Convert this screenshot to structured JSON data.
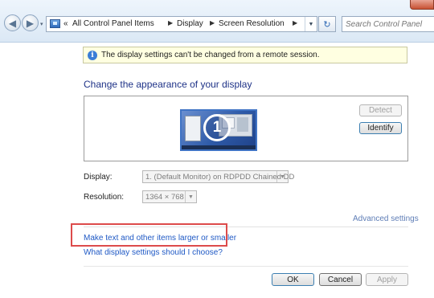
{
  "nav": {
    "back_glyph": "◀",
    "forward_glyph": "▶",
    "recent_glyph": "▾",
    "address_icon": "control-panel-icon",
    "breadcrumb_overflow": "«",
    "breadcrumbs": [
      "All Control Panel Items",
      "Display",
      "Screen Resolution"
    ],
    "refresh_glyph": "↻",
    "search_placeholder": "Search Control Panel"
  },
  "infobar": {
    "icon": "info-icon",
    "text": "The display settings can't be changed from a remote session."
  },
  "heading": "Change the appearance of your display",
  "preview": {
    "monitor_number": "1",
    "detect_label": "Detect",
    "identify_label": "Identify"
  },
  "settings": {
    "display_label": "Display:",
    "display_value": "1. (Default Monitor) on RDPDD Chained DD",
    "resolution_label": "Resolution:",
    "resolution_value": "1364 × 768"
  },
  "links": {
    "advanced": "Advanced settings",
    "text_size": "Make text and other items larger or smaller",
    "which_settings": "What display settings should I choose?"
  },
  "buttons": {
    "ok": "OK",
    "cancel": "Cancel",
    "apply": "Apply"
  },
  "colors": {
    "link": "#1f59c5",
    "heading": "#1e3287",
    "highlight": "#dd4b4b",
    "infobar_bg": "#ffffe1"
  }
}
